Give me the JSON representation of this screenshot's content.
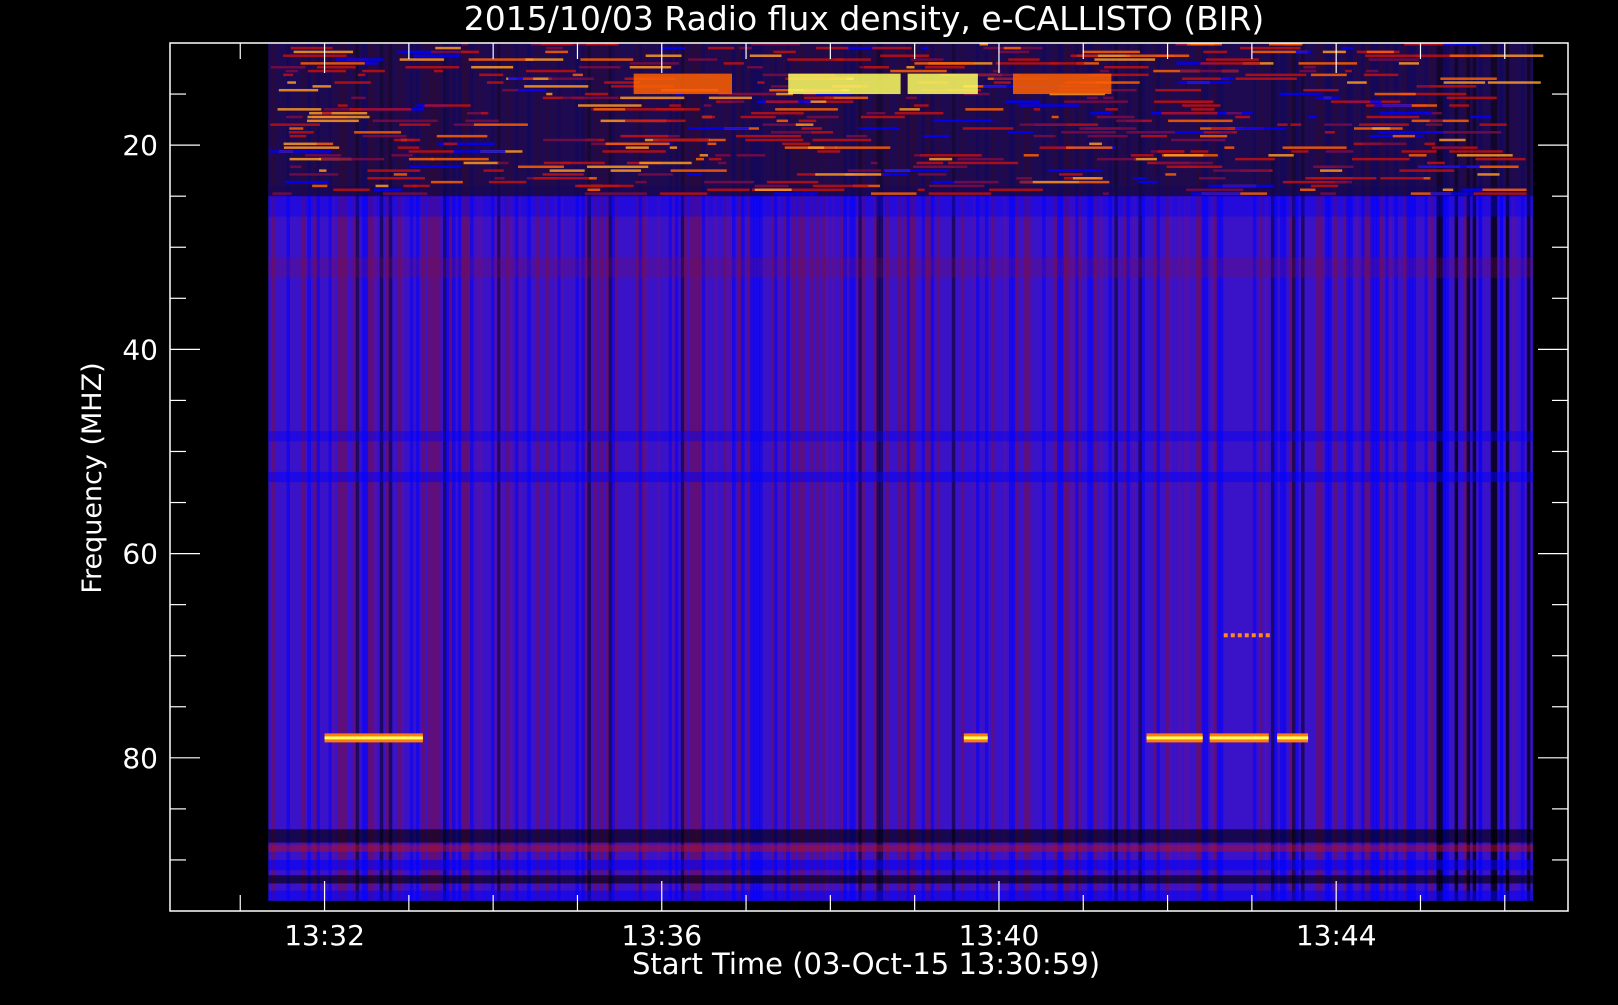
{
  "chart_data": {
    "type": "heatmap",
    "title": "2015/10/03  Radio flux density, e-CALLISTO (BIR)",
    "xlabel": "Start Time (03-Oct-15 13:30:59)",
    "ylabel": "Frequency (MHZ)",
    "xlim_minutes": [
      13.0,
      13.0
    ],
    "x_axis": {
      "start": "13:30:59",
      "data_start": "13:31:20",
      "data_end": "13:46:20",
      "range": [
        "13:30:10",
        "13:46:45"
      ],
      "ticks": [
        "13:32",
        "13:36",
        "13:40",
        "13:44"
      ]
    },
    "y_axis": {
      "range_mhz": [
        95,
        10
      ],
      "data_range_mhz": [
        94,
        10
      ],
      "ticks": [
        20,
        40,
        60,
        80
      ],
      "tick_labels": [
        "20",
        "40",
        "60",
        "80"
      ],
      "inverted": true
    },
    "colormap": [
      "#000000",
      "#0000ff",
      "#7a0c45",
      "#c01010",
      "#ff6000",
      "#ffff60"
    ],
    "features": {
      "interference_band_mhz": [
        10,
        25
      ],
      "strong_emission_mhz": [
        13,
        15
      ],
      "narrowband_lines_mhz": 78,
      "narrowband_segments": [
        [
          "13:32:00",
          "13:33:10"
        ],
        [
          "13:39:35",
          "13:39:52"
        ],
        [
          "13:41:45",
          "13:42:25"
        ],
        [
          "13:42:30",
          "13:43:12"
        ],
        [
          "13:43:18",
          "13:43:40"
        ]
      ],
      "secondary_line_mhz": 68,
      "secondary_line_segment": [
        "13:42:40",
        "13:43:10"
      ]
    }
  }
}
